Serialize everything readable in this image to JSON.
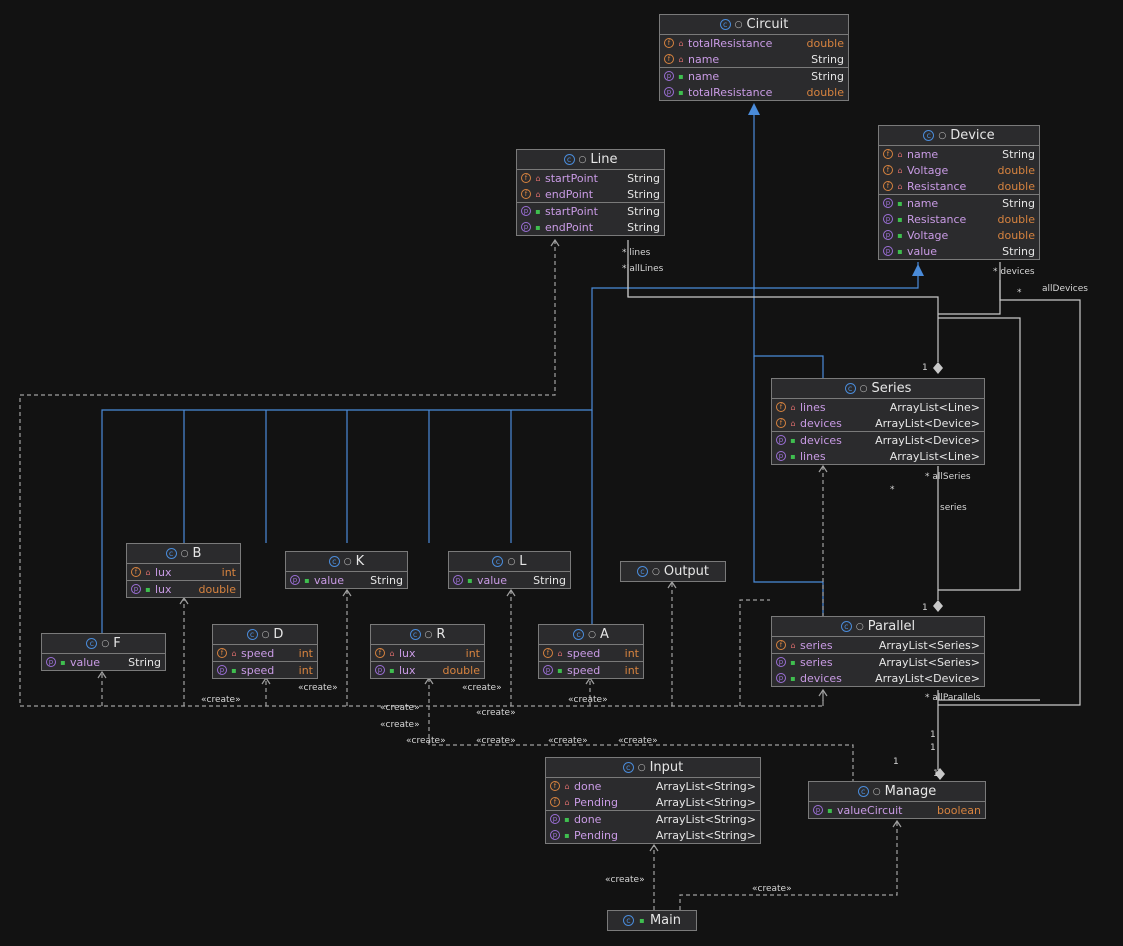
{
  "classes": [
    {
      "id": "circuit",
      "name": "Circuit",
      "fields": [
        [
          "totalResistance",
          "double"
        ],
        [
          "name",
          "String"
        ]
      ],
      "props": [
        [
          "name",
          "String"
        ],
        [
          "totalResistance",
          "double"
        ]
      ]
    },
    {
      "id": "line",
      "name": "Line",
      "fields": [
        [
          "startPoint",
          "String"
        ],
        [
          "endPoint",
          "String"
        ]
      ],
      "props": [
        [
          "startPoint",
          "String"
        ],
        [
          "endPoint",
          "String"
        ]
      ]
    },
    {
      "id": "device",
      "name": "Device",
      "fields": [
        [
          "name",
          "String"
        ],
        [
          "Voltage",
          "double"
        ],
        [
          "Resistance",
          "double"
        ]
      ],
      "props": [
        [
          "name",
          "String"
        ],
        [
          "Resistance",
          "double"
        ],
        [
          "Voltage",
          "double"
        ],
        [
          "value",
          "String"
        ]
      ]
    },
    {
      "id": "series",
      "name": "Series",
      "fields": [
        [
          "lines",
          "ArrayList<Line>"
        ],
        [
          "devices",
          "ArrayList<Device>"
        ]
      ],
      "props": [
        [
          "devices",
          "ArrayList<Device>"
        ],
        [
          "lines",
          "ArrayList<Line>"
        ]
      ]
    },
    {
      "id": "parallel",
      "name": "Parallel",
      "fields": [
        [
          "series",
          "ArrayList<Series>"
        ]
      ],
      "props": [
        [
          "series",
          "ArrayList<Series>"
        ],
        [
          "devices",
          "ArrayList<Device>"
        ]
      ]
    },
    {
      "id": "b",
      "name": "B",
      "fields": [
        [
          "lux",
          "int"
        ]
      ],
      "props": [
        [
          "lux",
          "double"
        ]
      ]
    },
    {
      "id": "k",
      "name": "K",
      "fields": [],
      "props": [
        [
          "value",
          "String"
        ]
      ]
    },
    {
      "id": "l",
      "name": "L",
      "fields": [],
      "props": [
        [
          "value",
          "String"
        ]
      ]
    },
    {
      "id": "output",
      "name": "Output",
      "fields": [],
      "props": []
    },
    {
      "id": "f",
      "name": "F",
      "fields": [],
      "props": [
        [
          "value",
          "String"
        ]
      ]
    },
    {
      "id": "d",
      "name": "D",
      "fields": [
        [
          "speed",
          "int"
        ]
      ],
      "props": [
        [
          "speed",
          "int"
        ]
      ]
    },
    {
      "id": "r",
      "name": "R",
      "fields": [
        [
          "lux",
          "int"
        ]
      ],
      "props": [
        [
          "lux",
          "double"
        ]
      ]
    },
    {
      "id": "a",
      "name": "A",
      "fields": [
        [
          "speed",
          "int"
        ]
      ],
      "props": [
        [
          "speed",
          "int"
        ]
      ]
    },
    {
      "id": "input",
      "name": "Input",
      "fields": [
        [
          "done",
          "ArrayList<String>"
        ],
        [
          "Pending",
          "ArrayList<String>"
        ]
      ],
      "props": [
        [
          "done",
          "ArrayList<String>"
        ],
        [
          "Pending",
          "ArrayList<String>"
        ]
      ]
    },
    {
      "id": "manage",
      "name": "Manage",
      "fields": [],
      "props": [
        [
          "valueCircuit",
          "boolean"
        ]
      ]
    },
    {
      "id": "main",
      "name": "Main",
      "fields": [],
      "props": []
    }
  ],
  "labels": [
    {
      "id": "lines-mult",
      "text": "* lines"
    },
    {
      "id": "alllines",
      "text": "* allLines"
    },
    {
      "id": "devices-mult",
      "text": "* devices"
    },
    {
      "id": "alldevices-star",
      "text": "*"
    },
    {
      "id": "alldevices",
      "text": "allDevices"
    },
    {
      "id": "series-one",
      "text": "1"
    },
    {
      "id": "allseries",
      "text": "* allSeries"
    },
    {
      "id": "star-left",
      "text": "*"
    },
    {
      "id": "series-role",
      "text": "series"
    },
    {
      "id": "parallel-one",
      "text": "1"
    },
    {
      "id": "allparallels",
      "text": "* allParallels"
    },
    {
      "id": "manage-one-a",
      "text": "1"
    },
    {
      "id": "manage-one-b",
      "text": "1"
    },
    {
      "id": "manage-one-c",
      "text": "1"
    },
    {
      "id": "manage-one-d",
      "text": "1"
    },
    {
      "id": "create-1",
      "text": "«create»"
    },
    {
      "id": "create-2",
      "text": "«create»"
    },
    {
      "id": "create-3",
      "text": "«create»"
    },
    {
      "id": "create-4",
      "text": "«create»"
    },
    {
      "id": "create-5",
      "text": "«create»"
    },
    {
      "id": "create-6",
      "text": "«create»"
    },
    {
      "id": "create-7",
      "text": "«create»"
    },
    {
      "id": "create-8",
      "text": "«create»"
    },
    {
      "id": "create-9",
      "text": "«create»"
    },
    {
      "id": "create-10",
      "text": "«create»"
    },
    {
      "id": "create-11",
      "text": "«create»"
    },
    {
      "id": "create-12",
      "text": "«create»"
    },
    {
      "id": "create-13",
      "text": "«create»"
    }
  ],
  "colors": {
    "background": "#121212",
    "box": "#2b2b2d",
    "border": "#7a7a7a",
    "inheritance": "#4a8bd9",
    "association": "#c8c8c8",
    "field_name": "#c99be5",
    "primitive_type": "#d7833f",
    "public": "#3fbf4f",
    "private": "#d66b6b"
  },
  "icons": {
    "class": "class-icon",
    "field": "field-icon",
    "property": "property-icon",
    "public": "public-lock-open-icon",
    "private": "private-lock-icon"
  }
}
